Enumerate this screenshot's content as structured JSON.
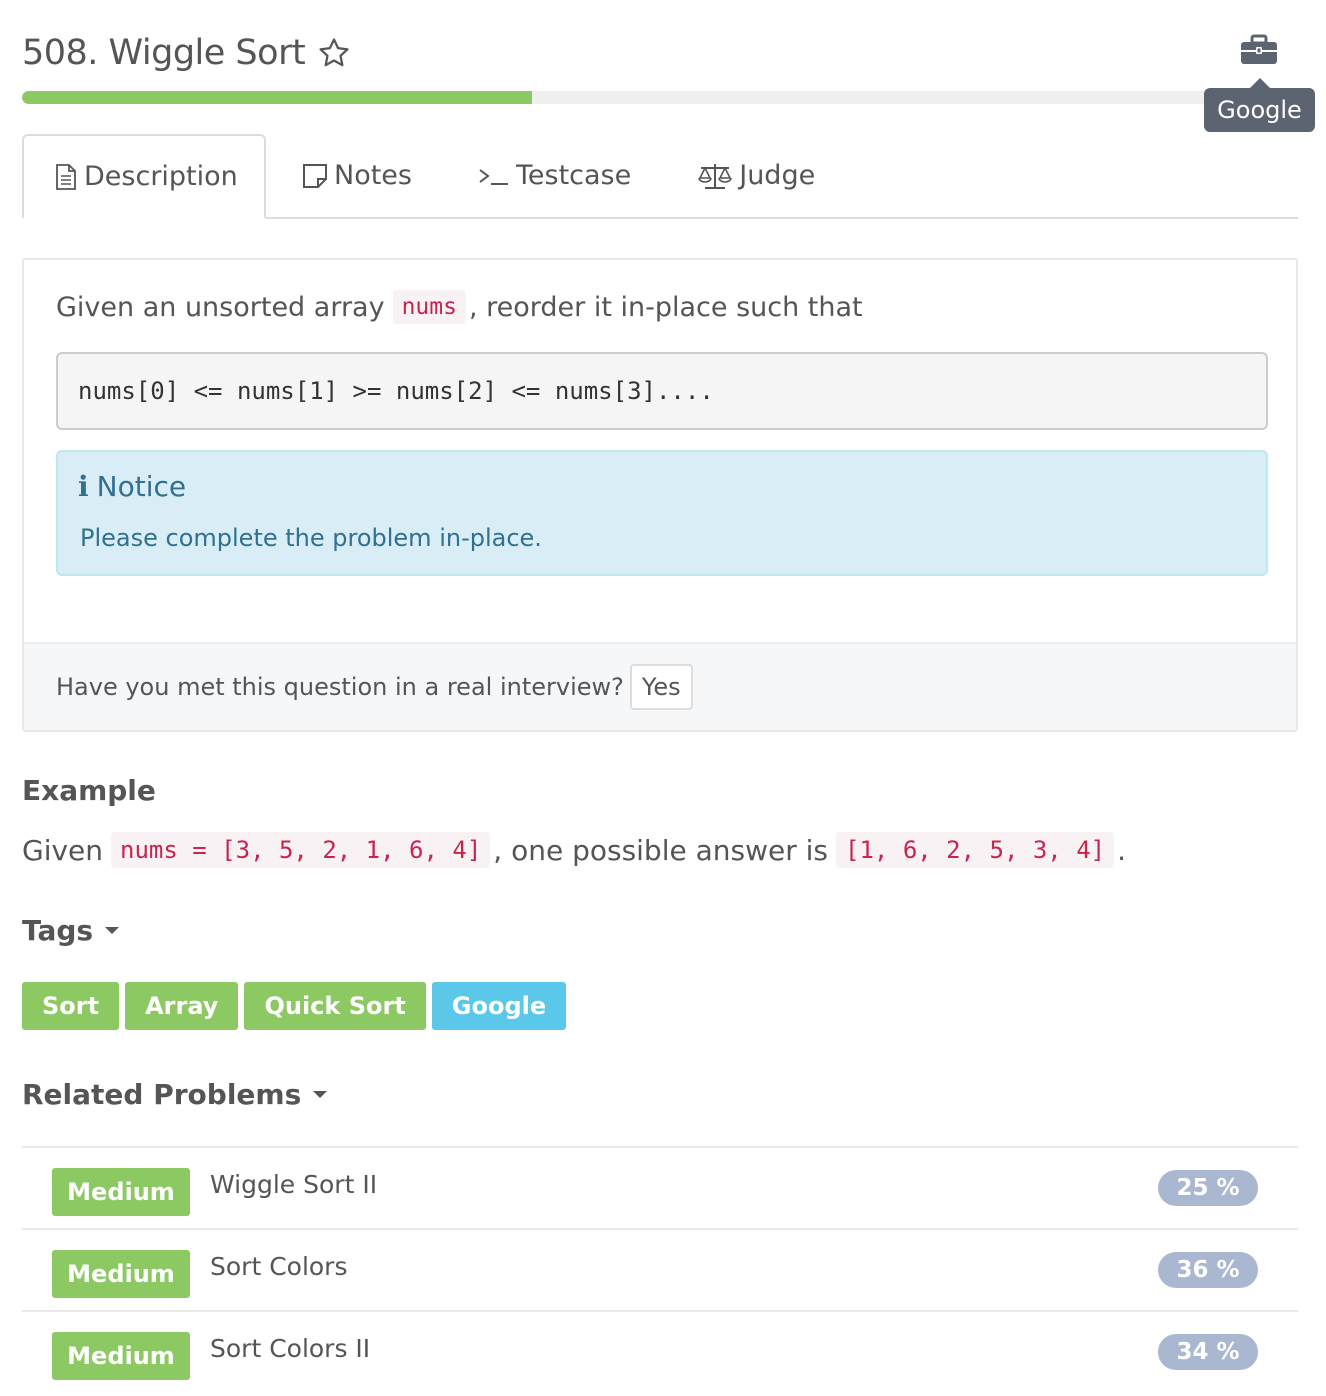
{
  "header": {
    "title": "508. Wiggle Sort",
    "progress_percent": 40,
    "company_tooltip": "Google",
    "icons": {
      "favorite": "star-outline-icon",
      "company": "briefcase-icon"
    }
  },
  "tabs": [
    {
      "label": "Description",
      "icon": "document-icon",
      "active": true
    },
    {
      "label": "Notes",
      "icon": "note-icon",
      "active": false
    },
    {
      "label": "Testcase",
      "icon": "terminal-icon",
      "active": false
    },
    {
      "label": "Judge",
      "icon": "balance-scale-icon",
      "active": false
    }
  ],
  "description": {
    "intro_before": "Given an unsorted array",
    "intro_code": "nums",
    "intro_after": ", reorder it in-place such that",
    "code_block": "nums[0] <= nums[1] >= nums[2] <= nums[3]....",
    "notice_title": "Notice",
    "notice_text": "Please complete the problem in-place.",
    "interview_question": "Have you met this question in a real interview?",
    "yes_label": "Yes"
  },
  "example": {
    "heading": "Example",
    "prefix": "Given",
    "input_code": "nums = [3, 5, 2, 1, 6, 4]",
    "middle": ", one possible answer is",
    "answer_code": "[1, 6, 2, 5, 3, 4]",
    "suffix": "."
  },
  "tags": {
    "heading": "Tags",
    "items": [
      {
        "label": "Sort",
        "color": "#8cc963"
      },
      {
        "label": "Array",
        "color": "#8cc963"
      },
      {
        "label": "Quick Sort",
        "color": "#8cc963"
      },
      {
        "label": "Google",
        "color": "#5bc8ea"
      }
    ]
  },
  "related": {
    "heading": "Related Problems",
    "items": [
      {
        "difficulty": "Medium",
        "name": "Wiggle Sort II",
        "rate": "25 %"
      },
      {
        "difficulty": "Medium",
        "name": "Sort Colors",
        "rate": "36 %"
      },
      {
        "difficulty": "Medium",
        "name": "Sort Colors II",
        "rate": "34 %"
      }
    ]
  },
  "colors": {
    "accent_green": "#8cc963",
    "accent_blue": "#5bc8ea",
    "tooltip_bg": "#5d6471",
    "rate_badge": "#a9b7d0"
  }
}
